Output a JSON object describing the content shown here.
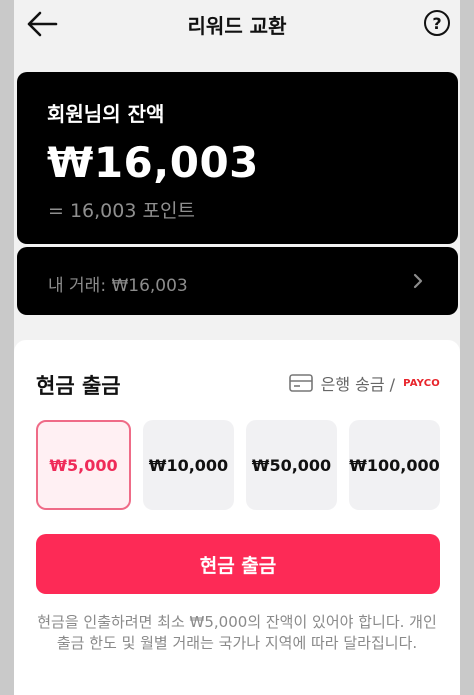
{
  "header": {
    "title": "리워드 교환",
    "back_icon": "arrow-left-icon",
    "help_label": "?"
  },
  "balance": {
    "label": "회원님의 잔액",
    "amount": "₩16,003",
    "points": "= 16,003 포인트"
  },
  "transactions": {
    "label": "내 거래: ₩16,003",
    "chevron_icon": "chevron-right-icon"
  },
  "withdraw": {
    "title": "현금 출금",
    "method_label": "은행 송금 /",
    "method_icon": "card-icon",
    "payco_logo": "PAYCO",
    "options": [
      {
        "label": "₩5,000",
        "selected": true
      },
      {
        "label": "₩10,000",
        "selected": false
      },
      {
        "label": "₩50,000",
        "selected": false
      },
      {
        "label": "₩100,000",
        "selected": false
      }
    ],
    "button_label": "현금 출금",
    "notice": "현금을 인출하려면 최소 ₩5,000의 잔액이 있어야 합니다. 개인 출금 한도 및 월별 거래는 국가나 지역에 따라 달라집니다."
  },
  "colors": {
    "accent": "#fd2a56",
    "selected_border": "#ef6b87",
    "card_background": "#000000"
  }
}
